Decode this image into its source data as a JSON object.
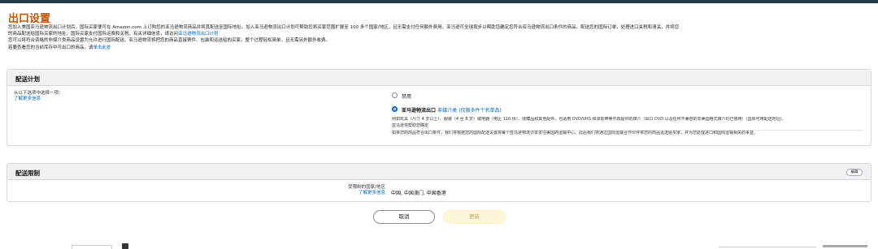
{
  "page": {
    "title": "出口设置",
    "intro": {
      "line1": "您加入美国亚马逊物流出口计划后，国际买家便可在 Amazon.com 上订购您的亚马逊物流商品并将其配送至国际地址。加入亚马逊物流出口计划可帮助您将买家范围扩展至 100 多个国家/地区，且无需支付任何额外费用。亚马逊可全球按步以帮助您确定您符合亚马逊物流出口条件的商品，配送您的国际订单，处理进口关税和清关，并将您",
      "line2_text": "的商品配送给国际买家的地址。国际买家支付国际运费和关税。有关详细信息，请访问",
      "line2_link": "亚马逊物流出口计划",
      "line3": "您可以将符合资格的非媒介类商品设置为允许进行国际配送。亚马逊物流将把您的商品直接寄件、包装和运送给的买家。整个过程轻松简单，且无需另外额外收费。",
      "line4_text": "若要查看您的当前库存中可出口的商品，请",
      "line4_link": "单击此处"
    }
  },
  "fulfillment_plan": {
    "heading": "配送计划",
    "prompt": "从以下选项中选择一项：",
    "learn_more": "了解更多信息",
    "options": [
      {
        "label": "禁用",
        "selected": false
      },
      {
        "label": "亚马逊物流出口",
        "label_extra": "非媒介类",
        "label_note": "(仅限多件个名单品)",
        "selected": true
      }
    ],
    "desc_line1": "例如玩具（尺寸 4 岁以上）、服装（4 至 8 岁）或电器（电压 110 伏）、收藏品和其他配件。也适用 DVD/VHS 和录影带等不再提供的媒介（出口 DVD 以及任何不兼容的非美国格式媒介均已禁用）(国际可用配送地址)。",
    "desc_line2": "亚马逊将帮助您确定",
    "desc_line3": "如果您的商品符合出口条件，我们将根据您的国际配送设置将每个亚马逊物流订单发往美国的运输中心。此后我们将通过国际运输合作伙伴将您的商品运送给买家，并为您处理进口和国际运输相关的事宜。"
  },
  "shipping_restrictions": {
    "heading": "配送限制",
    "edit_label": "编辑",
    "restricted_label": "受限制的国家/地区",
    "learn_more": "了解更多信息",
    "value": "中国, 中国澳门, 中国香港"
  },
  "actions": {
    "cancel": "取消",
    "update": "更新"
  }
}
